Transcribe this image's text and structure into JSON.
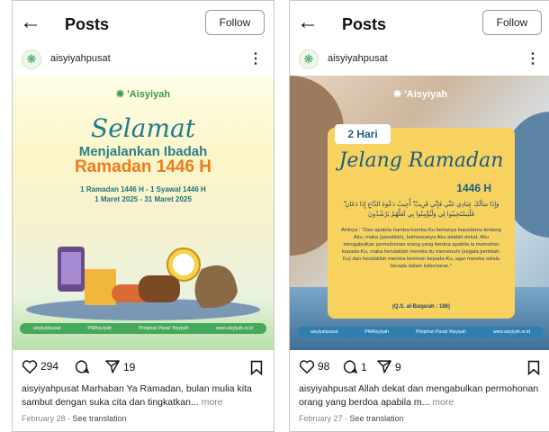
{
  "posts": [
    {
      "header": {
        "back_icon": "←",
        "title": "Posts",
        "follow_label": "Follow"
      },
      "user": {
        "name": "aisyiyahpusat",
        "avatar_icon": "❋",
        "more_icon": "⋮"
      },
      "image": {
        "logo": "❋ 'Aisyiyah",
        "selamat": "Selamat",
        "menjalankan": "Menjalankan Ibadah",
        "ramadan": "Ramadan 1446 H",
        "date_line_1": "1 Ramadan 1446 H - 1 Syawal 1446 H",
        "date_line_2": "1 Maret 2025 - 31 Maret 2025",
        "footer_items": [
          "aisyiyahpusat",
          "PWAisyiyah",
          "Pimpinan Pusat 'Aisyiyah",
          "www.aisyiyah.or.id"
        ]
      },
      "likes": "294",
      "comments": "",
      "shares": "19",
      "caption_user": "aisyiyahpusat",
      "caption_text": " Marhaban Ya Ramadan, bulan mulia kita sambut dengan suka cita dan tingkatkan...",
      "caption_more": " more",
      "date": "February 28",
      "see_translation": "See translation"
    },
    {
      "header": {
        "back_icon": "←",
        "title": "Posts",
        "follow_label": "Follow"
      },
      "user": {
        "name": "aisyiyahpusat",
        "avatar_icon": "❋",
        "more_icon": "⋮"
      },
      "image": {
        "logo": "❋ 'Aisyiyah",
        "badge": "2 Hari",
        "jelang": "Jelang Ramadan",
        "year": "1446 H",
        "arabic": "وَإِذَا سَأَلَكَ عِبَادِي عَنِّي فَإِنِّي قَرِيبٌ ۖ أُجِيبُ دَعْوَةَ الدَّاعِ إِذَا دَعَانِ ۖ فَلْيَسْتَجِيبُوا لِي وَلْيُؤْمِنُوا بِي لَعَلَّهُمْ يَرْشُدُونَ",
        "artinya": "Artinya : \"Dan apabila hamba-hamba-Ku bertanya kepadamu tentang Aku, maka (jawablah), bahwasanya Aku adalah dekat. Aku mengabulkan permohonan orang yang berdoa apabila ia memohon kepada-Ku, maka hendaklah mereka itu memenuhi (segala perintah-Ku) dan hendaklah mereka beriman kepada-Ku, agar mereka selalu berada dalam kebenaran.\"",
        "source": "(Q.S. al-Baqarah : 186)",
        "footer_items": [
          "aisyiyahpusat",
          "PWAisyiyah",
          "Pimpinan Pusat 'Aisyiyah",
          "www.aisyiyah.or.id"
        ]
      },
      "likes": "98",
      "comments": "1",
      "shares": "9",
      "caption_user": "aisyiyahpusat",
      "caption_text": " Allah dekat dan mengabulkan permohonan orang yang berdoa apabila m...",
      "caption_more": " more",
      "date": "February 27",
      "see_translation": "See translation"
    }
  ],
  "colors": {
    "post1_orange": "#ef7a1a",
    "post1_teal": "#2d7f88",
    "post2_yellow": "#f7d25e",
    "post2_blue": "#1b5c82"
  },
  "icons": [
    "back-arrow-icon",
    "more-vertical-icon",
    "heart-icon",
    "comment-icon",
    "share-icon",
    "bookmark-icon"
  ]
}
